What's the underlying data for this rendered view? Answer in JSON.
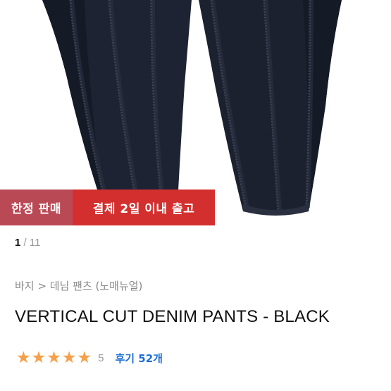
{
  "badges": {
    "limited": "한정 판매",
    "shipping": "결제 2일 이내 출고"
  },
  "pager": {
    "current": "1",
    "separator": "/",
    "total": "11"
  },
  "breadcrumb": {
    "category": "바지",
    "separator": ">",
    "subcategory": "데님 팬츠 (노매뉴얼)"
  },
  "product": {
    "title": "VERTICAL CUT DENIM PANTS - BLACK"
  },
  "rating": {
    "score": "5",
    "star_count": 5,
    "reviews_label": "후기 52개"
  },
  "colors": {
    "star": "#f6a04a",
    "limited_badge": "#b94a55",
    "shipping_badge": "#d32f2f",
    "reviews_link": "#1e6fd0"
  },
  "icons": {
    "star": "star-icon"
  }
}
